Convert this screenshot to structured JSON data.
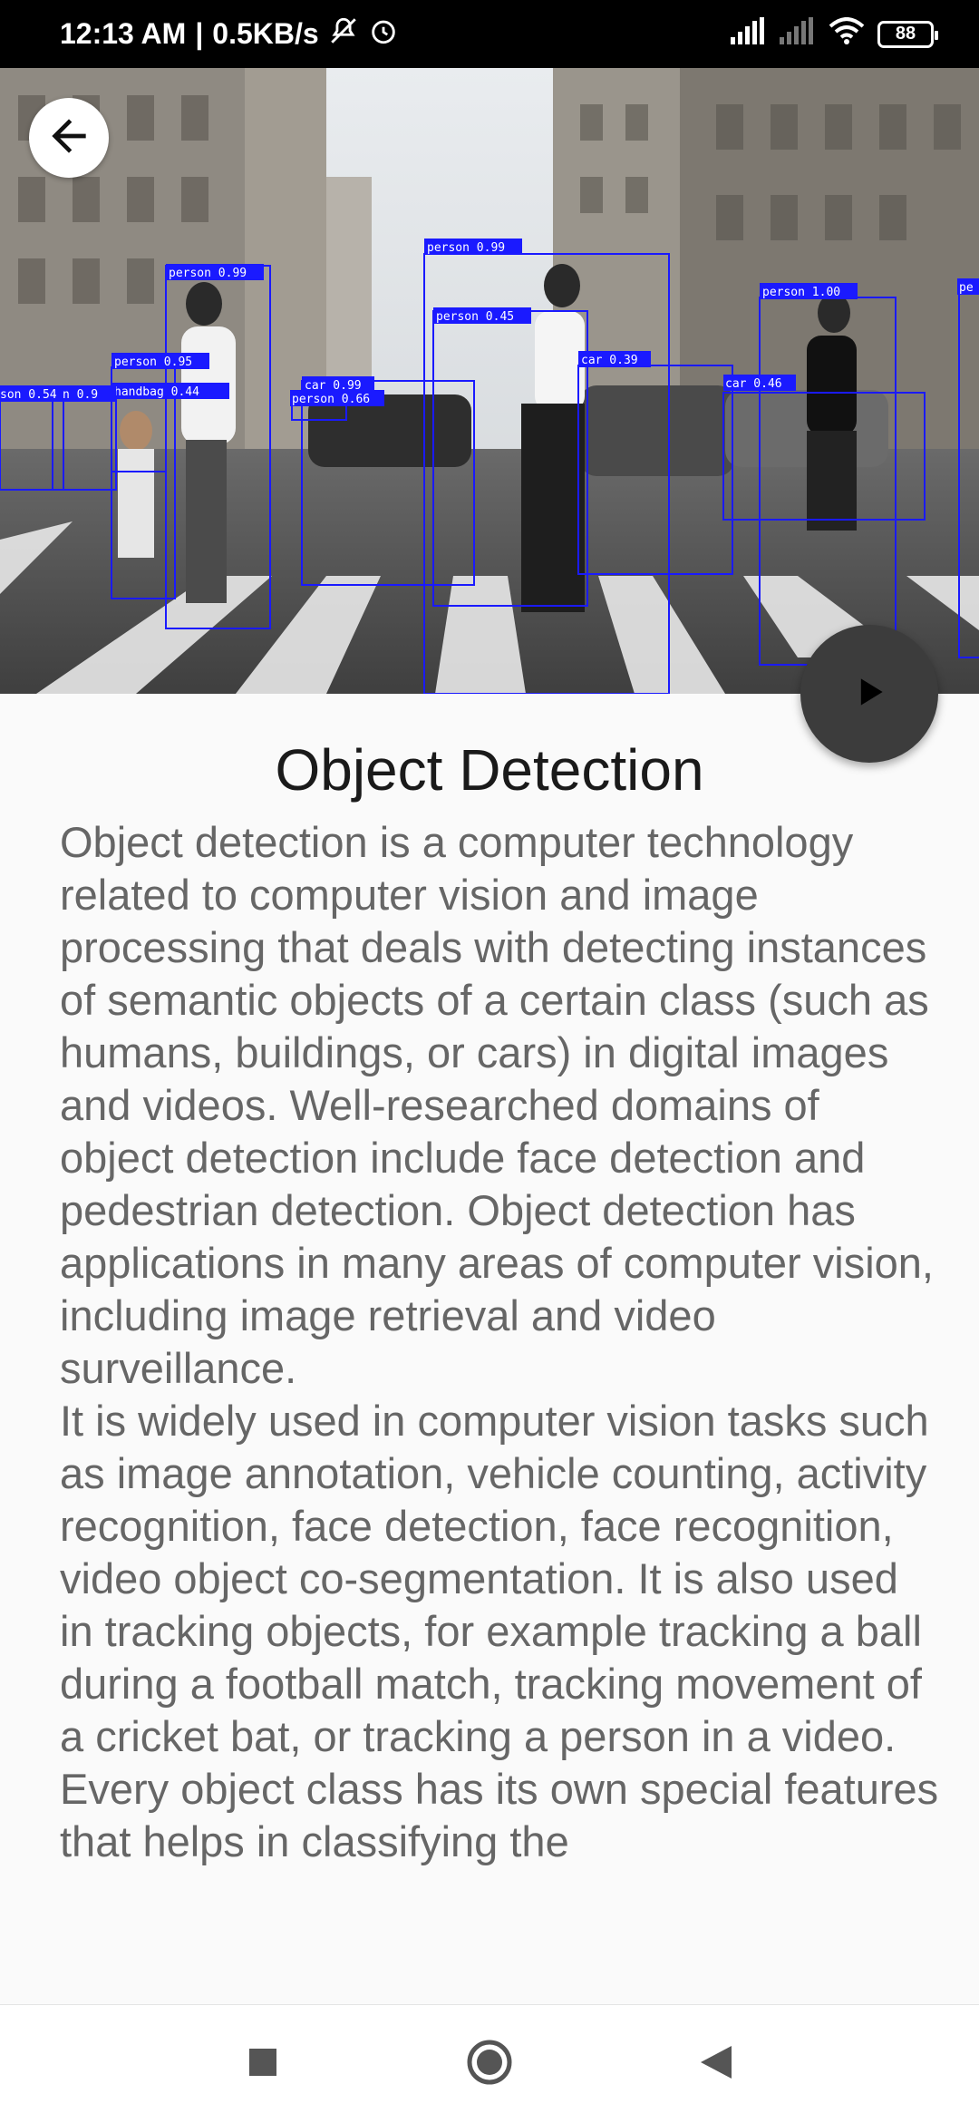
{
  "status_bar": {
    "time": "12:13 AM",
    "network_speed": "0.5KB/s",
    "battery_level": "88"
  },
  "hero": {
    "detections": [
      {
        "label": "person 0.99"
      },
      {
        "label": "person 0.99"
      },
      {
        "label": "person 0.45"
      },
      {
        "label": "person 0.95"
      },
      {
        "label": "handbag 0.44"
      },
      {
        "label": "car 0.99"
      },
      {
        "label": "person 0.66"
      },
      {
        "label": "car 0.39"
      },
      {
        "label": "car 0.46"
      },
      {
        "label": "person 1.00"
      },
      {
        "label": "son 0.54"
      },
      {
        "label": "n 0.9"
      },
      {
        "label": "pe"
      }
    ]
  },
  "page": {
    "title": "Object Detection",
    "paragraphs": [
      "Object detection is a computer technology related to computer vision and image processing that deals with detecting instances of semantic objects of a certain class (such as humans, buildings, or cars) in digital images and videos. Well-researched domains of object detection include face detection and pedestrian detection. Object detection has applications in many areas of computer vision, including image retrieval and video surveillance.",
      "It is widely used in computer vision tasks such as image annotation, vehicle counting, activity recognition, face detection, face recognition, video object co-segmentation. It is also used in tracking objects, for example tracking a ball during a football match, tracking movement of a cricket bat, or tracking a person in a video.",
      "Every object class has its own special features that helps in classifying the"
    ]
  },
  "icons": {
    "back": "arrow-left-icon",
    "play": "play-icon",
    "nav_recents": "square-icon",
    "nav_home": "circle-icon",
    "nav_back": "triangle-back-icon"
  },
  "colors": {
    "detection_box": "#1a1aff",
    "fab_background": "#3c3c3c"
  }
}
